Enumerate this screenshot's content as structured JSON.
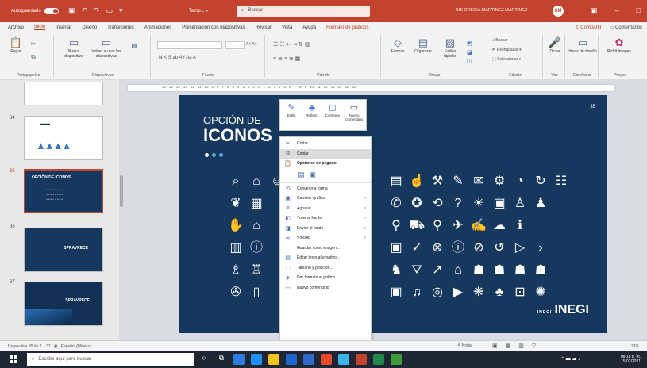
{
  "titlebar": {
    "autosave_label": "Autoguardado",
    "doc_title": "Temp... ▾",
    "search_placeholder": "Buscar",
    "user_name": "SIS ORECIA MARTINEZ MARTINEZ",
    "avatar_initials": "SM"
  },
  "tabs": [
    "Archivo",
    "Inicio",
    "Insertar",
    "Diseño",
    "Transiciones",
    "Animaciones",
    "Presentación con diapositivas",
    "Revisar",
    "Vista",
    "Ayuda",
    "Formato de gráficos"
  ],
  "share": {
    "share_label": "Compartir",
    "comments_label": "Comentarios"
  },
  "ribbon": {
    "groups": [
      "Portapapeles",
      "Diapositivas",
      "Fuente",
      "Párrafo",
      "Dibujo",
      "Edición",
      "Voz",
      "Diseñador",
      "Proyec"
    ],
    "paste_label": "Pegar",
    "new_slide_label": "Nueva diapositiva",
    "reuse_label": "Volver a usar las diapositivas",
    "shapes_label": "Formas",
    "arrange_label": "Organizar",
    "styles_label": "Estilos rápidos",
    "find_label": "Buscar",
    "replace_label": "Reemplazar",
    "select_label": "Seleccionar",
    "dictate_label": "Dictar",
    "design_ideas_label": "Ideas de diseño",
    "picker_label": "Pickit Images"
  },
  "ruler_text": "· 16 · 15 · 14 · 13 · 12 · 11 · 10 · 9 · 8 · 7 · 6 · 5 · 4 · 3 · 2 · 1 · 0 · 1 · 2 · 3 · 4 · 5 · 6 · 7 · 8 · 9 · 10 · 11 · 12 · 13 · 14 · 15 · 16 ·",
  "thumbnails": [
    {
      "num": "34",
      "title": "",
      "style": "light"
    },
    {
      "num": "35",
      "title": "OPCIÓN DE ICONOS",
      "style": "dark-selected"
    },
    {
      "num": "36",
      "title": "SPRAVRECE",
      "style": "dark"
    },
    {
      "num": "37",
      "title": "SPRAVRECE",
      "style": "dark"
    }
  ],
  "slide": {
    "subtitle": "OPCIÓN DE",
    "title": "ICONOS",
    "slide_number": "35",
    "brand": "INEGI",
    "brand_small": "INEGI"
  },
  "chart_toolbar": [
    {
      "label": "Estilo",
      "icon": "brush-icon"
    },
    {
      "label": "Relleno",
      "icon": "fill-icon"
    },
    {
      "label": "Contorno",
      "icon": "outline-icon"
    },
    {
      "label": "Nuevo comentario",
      "icon": "comment-icon"
    }
  ],
  "context_menu": {
    "cut": "Cortar",
    "copy": "Copiar",
    "paste_options": "Opciones de pegado:",
    "convert_shape": "Convertir a forma",
    "change_graphic": "Cambiar gráfico",
    "group": "Agrupar",
    "bring_front": "Traer al frente",
    "send_back": "Enviar al fondo",
    "link": "Vínculo",
    "save_image": "Guardar como imagen...",
    "alt_text": "Editar texto alternativo...",
    "size_position": "Tamaño y posición...",
    "format_graphic": "Dar formato al gráfico",
    "new_comment": "Nuevo comentario"
  },
  "status": {
    "slide_info": "Diapositiva 35 de 2... 37",
    "language": "Español (México)",
    "notes": "Notas",
    "zoom": "71%"
  },
  "taskbar": {
    "search_placeholder": "Escribe aquí para buscar",
    "time": "08:18 p. m.",
    "date": "15/02/2021"
  },
  "colors": {
    "titlebar": "#c4432e",
    "slide_bg": "#16385e",
    "accent_dots": "#5ca9dd"
  }
}
